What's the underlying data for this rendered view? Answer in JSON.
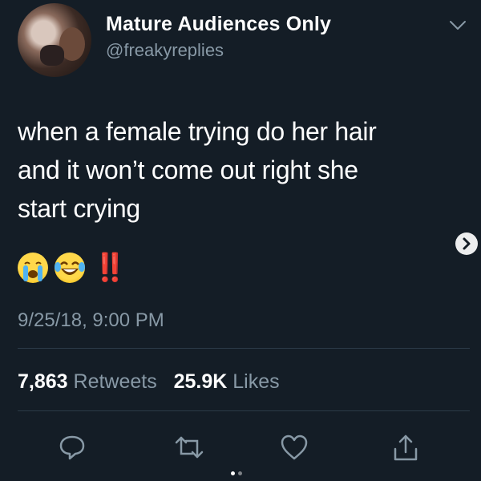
{
  "author": {
    "display_name": "Mature Audiences Only",
    "handle": "@freakyreplies"
  },
  "tweet": {
    "lines": [
      "when a female trying do her hair",
      "and it won’t come out right she",
      "start crying"
    ],
    "emoji_text": "‼️",
    "emojis": [
      "crying-face-icon",
      "tears-of-joy-face-icon",
      "double-exclamation-icon"
    ],
    "timestamp": "9/25/18, 9:00 PM"
  },
  "stats": {
    "retweets_count": "7,863",
    "retweets_label": "Retweets",
    "likes_count": "25.9K",
    "likes_label": "Likes"
  },
  "actions": [
    "reply-icon",
    "retweet-icon",
    "like-icon",
    "share-icon"
  ],
  "colors": {
    "background": "#141d26",
    "primary_text": "#ffffff",
    "secondary_text": "#8899a6",
    "divider": "#2c3a47"
  }
}
